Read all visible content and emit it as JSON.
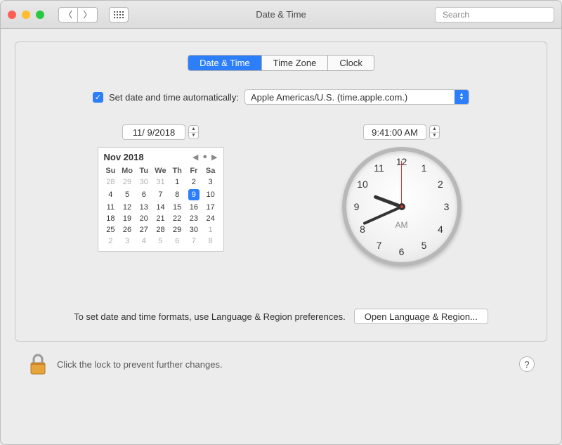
{
  "window": {
    "title": "Date & Time",
    "search_placeholder": "Search"
  },
  "tabs": {
    "date_time": "Date & Time",
    "time_zone": "Time Zone",
    "clock": "Clock"
  },
  "auto": {
    "checked": true,
    "label": "Set date and time automatically:",
    "server": "Apple Americas/U.S. (time.apple.com.)"
  },
  "date": {
    "value": "11/  9/2018",
    "month_title": "Nov 2018",
    "day_headers": [
      "Su",
      "Mo",
      "Tu",
      "We",
      "Th",
      "Fr",
      "Sa"
    ],
    "weeks": [
      [
        {
          "d": 28,
          "dim": true
        },
        {
          "d": 29,
          "dim": true
        },
        {
          "d": 30,
          "dim": true
        },
        {
          "d": 31,
          "dim": true
        },
        {
          "d": 1
        },
        {
          "d": 2
        },
        {
          "d": 3
        }
      ],
      [
        {
          "d": 4
        },
        {
          "d": 5
        },
        {
          "d": 6
        },
        {
          "d": 7
        },
        {
          "d": 8
        },
        {
          "d": 9,
          "sel": true
        },
        {
          "d": 10
        }
      ],
      [
        {
          "d": 11
        },
        {
          "d": 12
        },
        {
          "d": 13
        },
        {
          "d": 14
        },
        {
          "d": 15
        },
        {
          "d": 16
        },
        {
          "d": 17
        }
      ],
      [
        {
          "d": 18
        },
        {
          "d": 19
        },
        {
          "d": 20
        },
        {
          "d": 21
        },
        {
          "d": 22
        },
        {
          "d": 23
        },
        {
          "d": 24
        }
      ],
      [
        {
          "d": 25
        },
        {
          "d": 26
        },
        {
          "d": 27
        },
        {
          "d": 28
        },
        {
          "d": 29
        },
        {
          "d": 30
        },
        {
          "d": 1,
          "dim": true
        }
      ],
      [
        {
          "d": 2,
          "dim": true
        },
        {
          "d": 3,
          "dim": true
        },
        {
          "d": 4,
          "dim": true
        },
        {
          "d": 5,
          "dim": true
        },
        {
          "d": 6,
          "dim": true
        },
        {
          "d": 7,
          "dim": true
        },
        {
          "d": 8,
          "dim": true
        }
      ]
    ]
  },
  "time": {
    "value": "9:41:00 AM",
    "ampm": "AM",
    "hour_angle": 290.5,
    "minute_angle": 246,
    "second_angle": 0
  },
  "format": {
    "hint": "To set date and time formats, use Language & Region preferences.",
    "button": "Open Language & Region..."
  },
  "footer": {
    "lock_hint": "Click the lock to prevent further changes.",
    "help": "?"
  }
}
